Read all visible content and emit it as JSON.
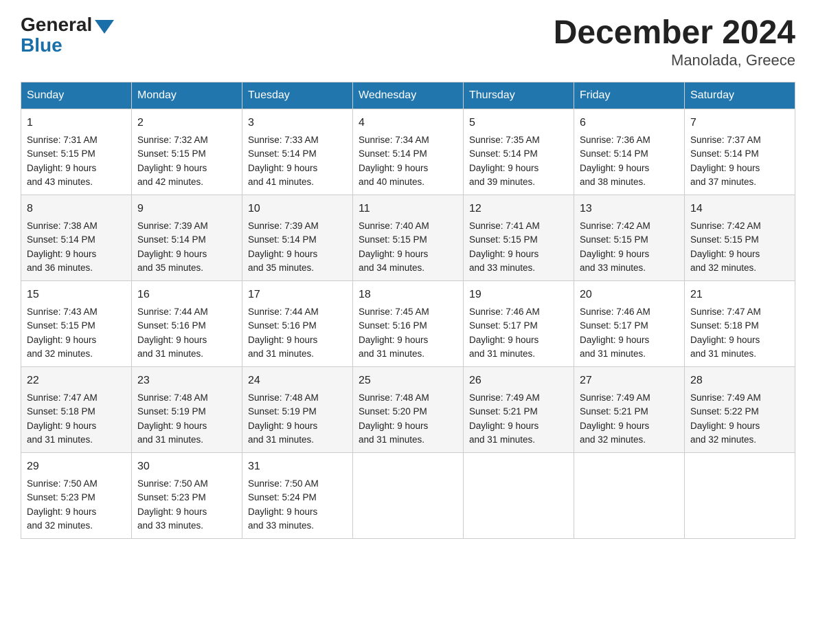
{
  "header": {
    "logo_general": "General",
    "logo_blue": "Blue",
    "title": "December 2024",
    "subtitle": "Manolada, Greece"
  },
  "days_of_week": [
    "Sunday",
    "Monday",
    "Tuesday",
    "Wednesday",
    "Thursday",
    "Friday",
    "Saturday"
  ],
  "weeks": [
    [
      {
        "day": "1",
        "sunrise": "7:31 AM",
        "sunset": "5:15 PM",
        "daylight": "9 hours and 43 minutes."
      },
      {
        "day": "2",
        "sunrise": "7:32 AM",
        "sunset": "5:15 PM",
        "daylight": "9 hours and 42 minutes."
      },
      {
        "day": "3",
        "sunrise": "7:33 AM",
        "sunset": "5:14 PM",
        "daylight": "9 hours and 41 minutes."
      },
      {
        "day": "4",
        "sunrise": "7:34 AM",
        "sunset": "5:14 PM",
        "daylight": "9 hours and 40 minutes."
      },
      {
        "day": "5",
        "sunrise": "7:35 AM",
        "sunset": "5:14 PM",
        "daylight": "9 hours and 39 minutes."
      },
      {
        "day": "6",
        "sunrise": "7:36 AM",
        "sunset": "5:14 PM",
        "daylight": "9 hours and 38 minutes."
      },
      {
        "day": "7",
        "sunrise": "7:37 AM",
        "sunset": "5:14 PM",
        "daylight": "9 hours and 37 minutes."
      }
    ],
    [
      {
        "day": "8",
        "sunrise": "7:38 AM",
        "sunset": "5:14 PM",
        "daylight": "9 hours and 36 minutes."
      },
      {
        "day": "9",
        "sunrise": "7:39 AM",
        "sunset": "5:14 PM",
        "daylight": "9 hours and 35 minutes."
      },
      {
        "day": "10",
        "sunrise": "7:39 AM",
        "sunset": "5:14 PM",
        "daylight": "9 hours and 35 minutes."
      },
      {
        "day": "11",
        "sunrise": "7:40 AM",
        "sunset": "5:15 PM",
        "daylight": "9 hours and 34 minutes."
      },
      {
        "day": "12",
        "sunrise": "7:41 AM",
        "sunset": "5:15 PM",
        "daylight": "9 hours and 33 minutes."
      },
      {
        "day": "13",
        "sunrise": "7:42 AM",
        "sunset": "5:15 PM",
        "daylight": "9 hours and 33 minutes."
      },
      {
        "day": "14",
        "sunrise": "7:42 AM",
        "sunset": "5:15 PM",
        "daylight": "9 hours and 32 minutes."
      }
    ],
    [
      {
        "day": "15",
        "sunrise": "7:43 AM",
        "sunset": "5:15 PM",
        "daylight": "9 hours and 32 minutes."
      },
      {
        "day": "16",
        "sunrise": "7:44 AM",
        "sunset": "5:16 PM",
        "daylight": "9 hours and 31 minutes."
      },
      {
        "day": "17",
        "sunrise": "7:44 AM",
        "sunset": "5:16 PM",
        "daylight": "9 hours and 31 minutes."
      },
      {
        "day": "18",
        "sunrise": "7:45 AM",
        "sunset": "5:16 PM",
        "daylight": "9 hours and 31 minutes."
      },
      {
        "day": "19",
        "sunrise": "7:46 AM",
        "sunset": "5:17 PM",
        "daylight": "9 hours and 31 minutes."
      },
      {
        "day": "20",
        "sunrise": "7:46 AM",
        "sunset": "5:17 PM",
        "daylight": "9 hours and 31 minutes."
      },
      {
        "day": "21",
        "sunrise": "7:47 AM",
        "sunset": "5:18 PM",
        "daylight": "9 hours and 31 minutes."
      }
    ],
    [
      {
        "day": "22",
        "sunrise": "7:47 AM",
        "sunset": "5:18 PM",
        "daylight": "9 hours and 31 minutes."
      },
      {
        "day": "23",
        "sunrise": "7:48 AM",
        "sunset": "5:19 PM",
        "daylight": "9 hours and 31 minutes."
      },
      {
        "day": "24",
        "sunrise": "7:48 AM",
        "sunset": "5:19 PM",
        "daylight": "9 hours and 31 minutes."
      },
      {
        "day": "25",
        "sunrise": "7:48 AM",
        "sunset": "5:20 PM",
        "daylight": "9 hours and 31 minutes."
      },
      {
        "day": "26",
        "sunrise": "7:49 AM",
        "sunset": "5:21 PM",
        "daylight": "9 hours and 31 minutes."
      },
      {
        "day": "27",
        "sunrise": "7:49 AM",
        "sunset": "5:21 PM",
        "daylight": "9 hours and 32 minutes."
      },
      {
        "day": "28",
        "sunrise": "7:49 AM",
        "sunset": "5:22 PM",
        "daylight": "9 hours and 32 minutes."
      }
    ],
    [
      {
        "day": "29",
        "sunrise": "7:50 AM",
        "sunset": "5:23 PM",
        "daylight": "9 hours and 32 minutes."
      },
      {
        "day": "30",
        "sunrise": "7:50 AM",
        "sunset": "5:23 PM",
        "daylight": "9 hours and 33 minutes."
      },
      {
        "day": "31",
        "sunrise": "7:50 AM",
        "sunset": "5:24 PM",
        "daylight": "9 hours and 33 minutes."
      },
      null,
      null,
      null,
      null
    ]
  ],
  "labels": {
    "sunrise": "Sunrise:",
    "sunset": "Sunset:",
    "daylight": "Daylight:"
  }
}
